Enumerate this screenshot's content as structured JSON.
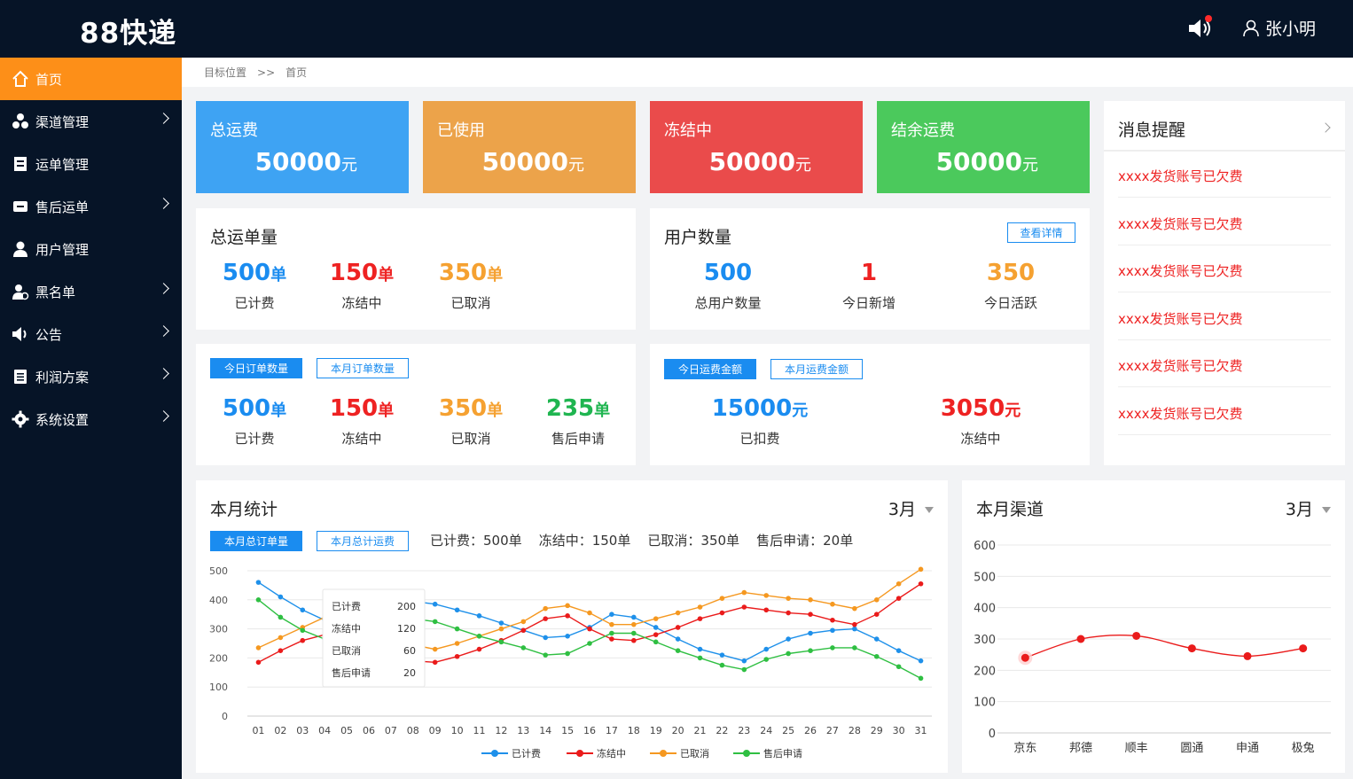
{
  "header": {
    "logo": "88快递",
    "user_name": "张小明"
  },
  "sidebar": {
    "items": [
      {
        "label": "首页",
        "icon": "home-icon",
        "active": true,
        "has_arrow": false
      },
      {
        "label": "渠道管理",
        "icon": "channel-icon",
        "active": false,
        "has_arrow": true
      },
      {
        "label": "运单管理",
        "icon": "waybill-icon",
        "active": false,
        "has_arrow": false
      },
      {
        "label": "售后运单",
        "icon": "aftersale-icon",
        "active": false,
        "has_arrow": true
      },
      {
        "label": "用户管理",
        "icon": "user-icon",
        "active": false,
        "has_arrow": false
      },
      {
        "label": "黑名单",
        "icon": "blacklist-icon",
        "active": false,
        "has_arrow": true
      },
      {
        "label": "公告",
        "icon": "announce-icon",
        "active": false,
        "has_arrow": true
      },
      {
        "label": "利润方案",
        "icon": "profit-icon",
        "active": false,
        "has_arrow": true
      },
      {
        "label": "系统设置",
        "icon": "settings-icon",
        "active": false,
        "has_arrow": true
      }
    ]
  },
  "breadcrumb": {
    "root": "目标位置",
    "sep": ">>",
    "current": "首页"
  },
  "stats": [
    {
      "label": "总运费",
      "value": "50000",
      "unit": "元",
      "color": "#3ea3f3"
    },
    {
      "label": "已使用",
      "value": "50000",
      "unit": "元",
      "color": "#eca34a"
    },
    {
      "label": "冻结中",
      "value": "50000",
      "unit": "元",
      "color": "#ea4b4b"
    },
    {
      "label": "结余运费",
      "value": "50000",
      "unit": "元",
      "color": "#4bc95c"
    }
  ],
  "total_orders": {
    "title": "总运单量",
    "metrics": [
      {
        "value": "500",
        "unit": "单",
        "caption": "已计费"
      },
      {
        "value": "150",
        "unit": "单",
        "caption": "冻结中"
      },
      {
        "value": "350",
        "unit": "单",
        "caption": "已取消"
      }
    ]
  },
  "users": {
    "title": "用户数量",
    "detail_button": "查看详情",
    "metrics": [
      {
        "value": "500",
        "caption": "总用户数量"
      },
      {
        "value": "1",
        "caption": "今日新增"
      },
      {
        "value": "350",
        "caption": "今日活跃"
      }
    ]
  },
  "order_count": {
    "tabs": [
      "今日订单数量",
      "本月订单数量"
    ],
    "metrics": [
      {
        "value": "500",
        "unit": "单",
        "caption": "已计费"
      },
      {
        "value": "150",
        "unit": "单",
        "caption": "冻结中"
      },
      {
        "value": "350",
        "unit": "单",
        "caption": "已取消"
      },
      {
        "value": "235",
        "unit": "单",
        "caption": "售后申请"
      }
    ]
  },
  "freight_amount": {
    "tabs": [
      "今日运费金额",
      "本月运费金额"
    ],
    "metrics": [
      {
        "value": "15000",
        "unit": "元",
        "caption": "已扣费"
      },
      {
        "value": "3050",
        "unit": "元",
        "caption": "冻结中"
      }
    ]
  },
  "messages": {
    "title": "消息提醒",
    "items": [
      "xxxx发货账号已欠费",
      "xxxx发货账号已欠费",
      "xxxx发货账号已欠费",
      "xxxx发货账号已欠费",
      "xxxx发货账号已欠费",
      "xxxx发货账号已欠费"
    ]
  },
  "monthly_stats": {
    "title": "本月统计",
    "month": "3月",
    "tabs": [
      "本月总订单量",
      "本月总计运费"
    ],
    "summary": "已计费：500单    冻结中：150单    已取消：350单    售后申请：20单",
    "tooltip": [
      {
        "label": "已计费",
        "value": "200"
      },
      {
        "label": "冻结中",
        "value": "120"
      },
      {
        "label": "已取消",
        "value": "60"
      },
      {
        "label": "售后申请",
        "value": "20"
      }
    ]
  },
  "monthly_channels": {
    "title": "本月渠道",
    "month": "3月"
  },
  "chart_data": [
    {
      "type": "line",
      "x": [
        "01",
        "02",
        "03",
        "04",
        "05",
        "06",
        "07",
        "08",
        "09",
        "10",
        "11",
        "12",
        "13",
        "14",
        "15",
        "16",
        "17",
        "18",
        "19",
        "20",
        "21",
        "22",
        "23",
        "24",
        "25",
        "26",
        "27",
        "28",
        "29",
        "30",
        "31"
      ],
      "ylim": [
        0,
        500
      ],
      "yticks": [
        0,
        100,
        200,
        300,
        400,
        500
      ],
      "legend_position": "bottom",
      "grid": true,
      "series": [
        {
          "name": "已计费",
          "color": "#1e90ea",
          "values": [
            460,
            410,
            365,
            330,
            340,
            360,
            385,
            395,
            385,
            365,
            345,
            320,
            295,
            270,
            275,
            305,
            350,
            340,
            305,
            265,
            230,
            210,
            190,
            230,
            265,
            285,
            295,
            300,
            265,
            225,
            190
          ]
        },
        {
          "name": "冻结中",
          "color": "#ea1b1b",
          "values": [
            185,
            225,
            260,
            280,
            285,
            275,
            235,
            190,
            185,
            205,
            230,
            260,
            295,
            335,
            345,
            300,
            265,
            260,
            280,
            305,
            335,
            355,
            375,
            365,
            355,
            350,
            330,
            315,
            350,
            405,
            455
          ]
        },
        {
          "name": "已取消",
          "color": "#f59820",
          "values": [
            235,
            270,
            305,
            340,
            345,
            330,
            290,
            245,
            230,
            250,
            275,
            300,
            325,
            370,
            380,
            355,
            315,
            315,
            335,
            355,
            375,
            405,
            425,
            415,
            405,
            400,
            385,
            370,
            400,
            455,
            505
          ]
        },
        {
          "name": "售后申请",
          "color": "#2fbf42",
          "values": [
            400,
            340,
            295,
            265,
            265,
            280,
            310,
            335,
            325,
            300,
            275,
            255,
            235,
            210,
            215,
            250,
            285,
            285,
            255,
            225,
            200,
            175,
            160,
            195,
            215,
            225,
            235,
            235,
            205,
            170,
            130
          ]
        }
      ]
    },
    {
      "type": "line",
      "categories": [
        "京东",
        "邦德",
        "顺丰",
        "圆通",
        "申通",
        "极兔"
      ],
      "values": [
        240,
        300,
        310,
        270,
        245,
        270
      ],
      "ylim": [
        0,
        600
      ],
      "yticks": [
        0,
        100,
        200,
        300,
        400,
        500,
        600
      ],
      "grid": true,
      "color": "#ea1b1b"
    }
  ]
}
